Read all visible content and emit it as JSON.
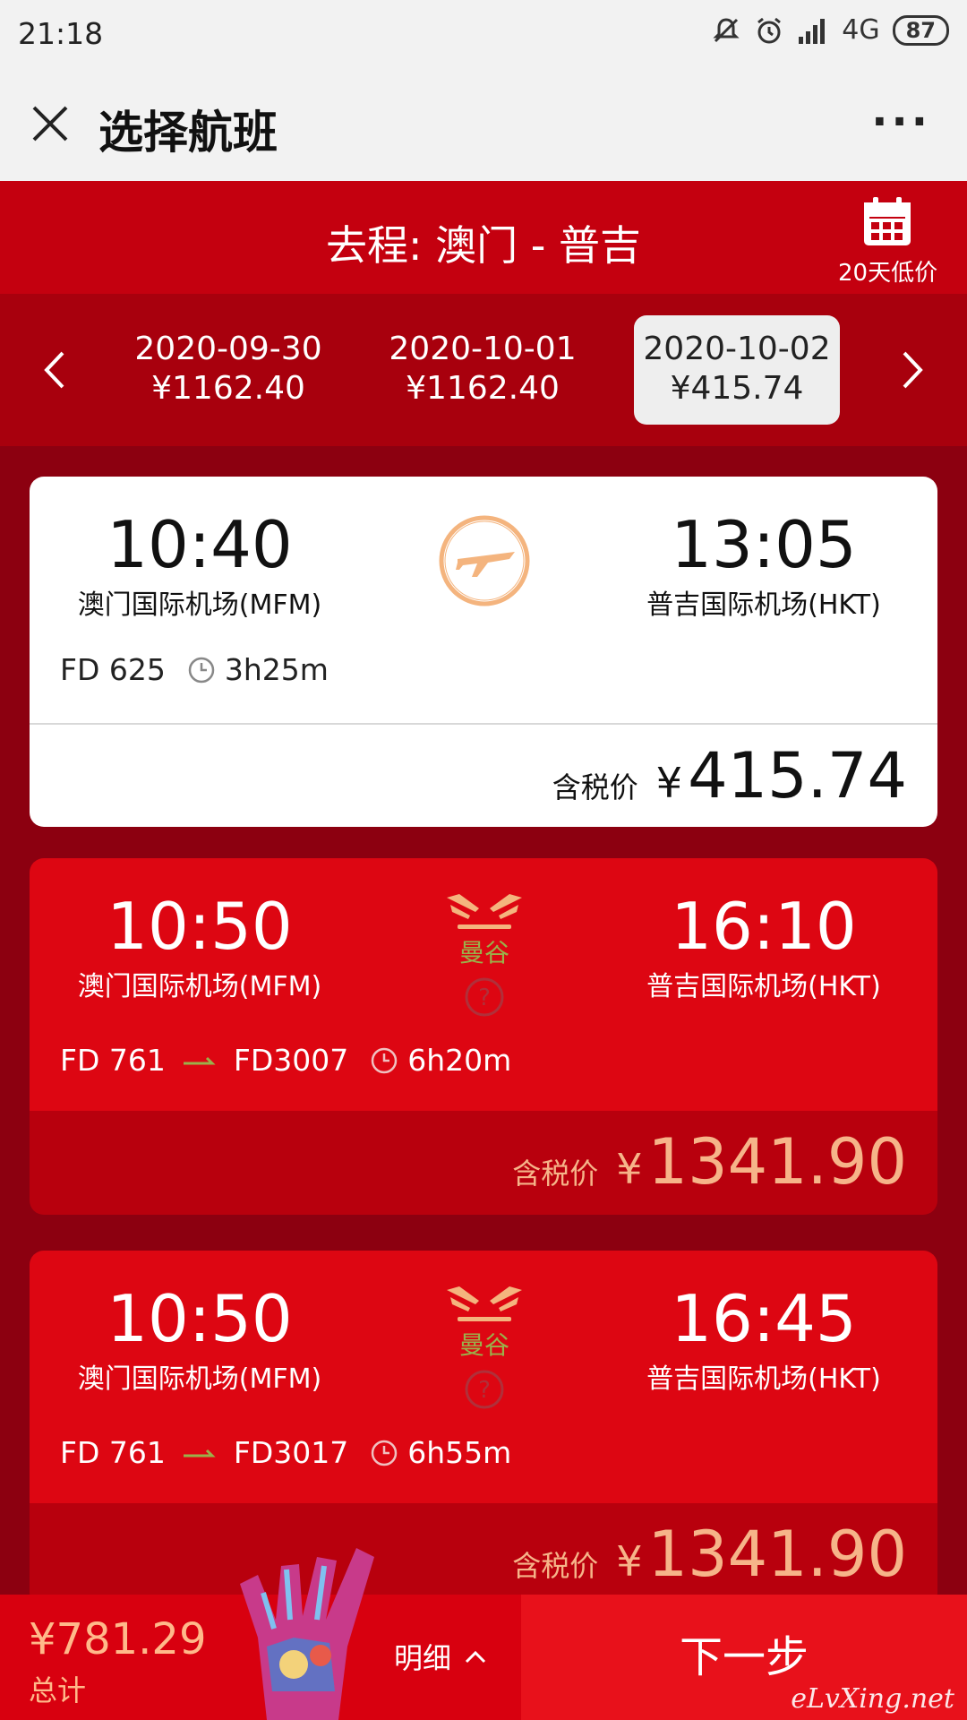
{
  "status_bar": {
    "time": "21:18",
    "network": "4G",
    "battery": "87"
  },
  "title_bar": {
    "title": "选择航班",
    "more": "···"
  },
  "route": {
    "title": "去程: 澳门 - 普吉",
    "calendar_label": "20天低价"
  },
  "dates": [
    {
      "date": "2020-09-30",
      "price": "¥1162.40",
      "selected": false
    },
    {
      "date": "2020-10-01",
      "price": "¥1162.40",
      "selected": false
    },
    {
      "date": "2020-10-02",
      "price": "¥415.74",
      "selected": true
    }
  ],
  "flights": [
    {
      "dep_time": "10:40",
      "dep_airport": "澳门国际机场(MFM)",
      "arr_time": "13:05",
      "arr_airport": "普吉国际机场(HKT)",
      "flight_no": "FD 625",
      "duration": "3h25m",
      "price_label": "含税价",
      "currency": "¥",
      "price": "415.74"
    },
    {
      "dep_time": "10:50",
      "dep_airport": "澳门国际机场(MFM)",
      "arr_time": "16:10",
      "arr_airport": "普吉国际机场(HKT)",
      "stop_city": "曼谷",
      "flight_no": "FD 761",
      "flight_no_2": "FD3007",
      "duration": "6h20m",
      "price_label": "含税价",
      "currency": "¥",
      "price": "1341.90"
    },
    {
      "dep_time": "10:50",
      "dep_airport": "澳门国际机场(MFM)",
      "arr_time": "16:45",
      "arr_airport": "普吉国际机场(HKT)",
      "stop_city": "曼谷",
      "flight_no": "FD 761",
      "flight_no_2": "FD3017",
      "duration": "6h55m",
      "price_label": "含税价",
      "currency": "¥",
      "price": "1341.90"
    }
  ],
  "bottom_bar": {
    "total_price": "¥781.29",
    "total_label": "总计",
    "detail_label": "明细",
    "next_label": "下一步",
    "watermark": "eLvXing.net"
  },
  "colors": {
    "brand_red": "#c4000f",
    "price_orange": "#f6b489",
    "stop_green": "#9ab14a"
  }
}
